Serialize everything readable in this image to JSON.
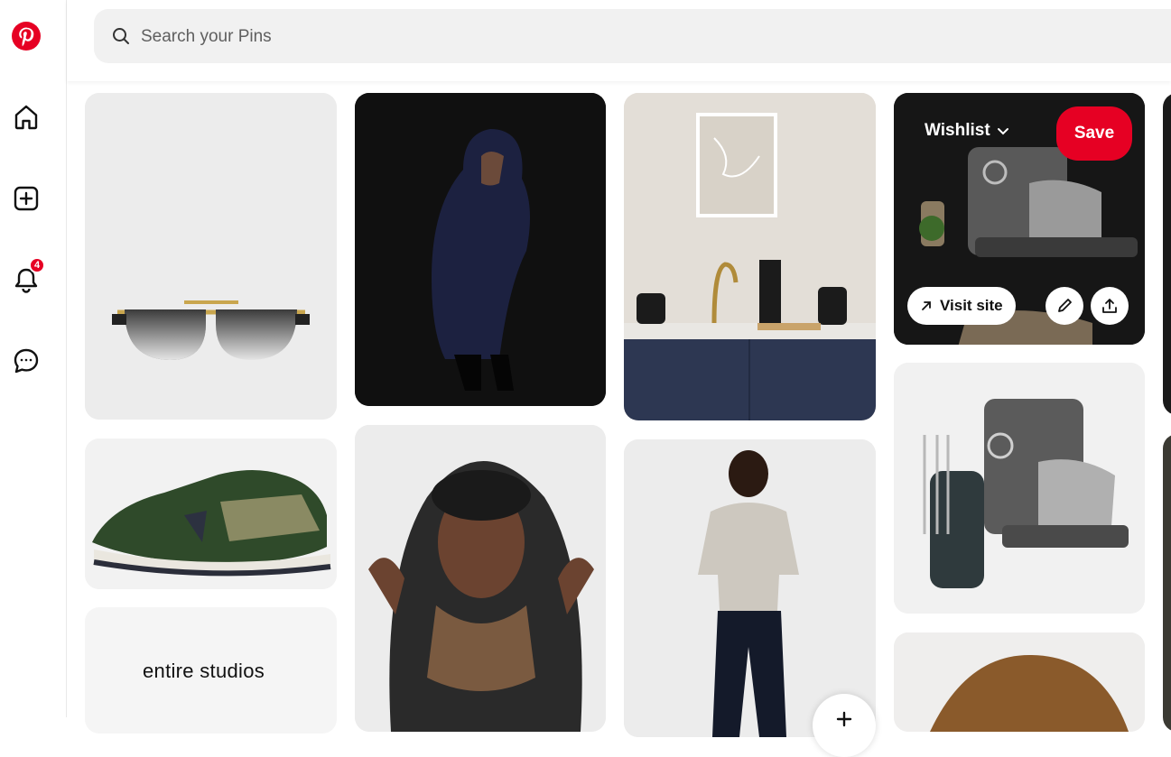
{
  "search": {
    "placeholder": "Search your Pins"
  },
  "sidebar": {
    "notifications_count": "4",
    "items": [
      {
        "name": "pinterest-logo-icon"
      },
      {
        "name": "home-icon"
      },
      {
        "name": "create-icon"
      },
      {
        "name": "notifications-icon"
      },
      {
        "name": "messages-icon"
      }
    ]
  },
  "hovered_pin": {
    "board_label": "Wishlist",
    "save_label": "Save",
    "visit_label": "Visit site"
  },
  "pins": [
    {
      "desc": "sunglasses"
    },
    {
      "desc": "hooded coat woman"
    },
    {
      "desc": "kitchen appliances"
    },
    {
      "desc": "stand mixer hover"
    },
    {
      "desc": "sneaker"
    },
    {
      "desc": "hood close-up"
    },
    {
      "desc": "woman in sweater"
    },
    {
      "desc": "mixer and hand blender"
    },
    {
      "desc": "entire studios"
    },
    {
      "desc": "straw hat"
    }
  ],
  "brand_pin_text": "entire studios",
  "colors": {
    "accent": "#e60023",
    "search_bg": "#f1f1f1"
  }
}
